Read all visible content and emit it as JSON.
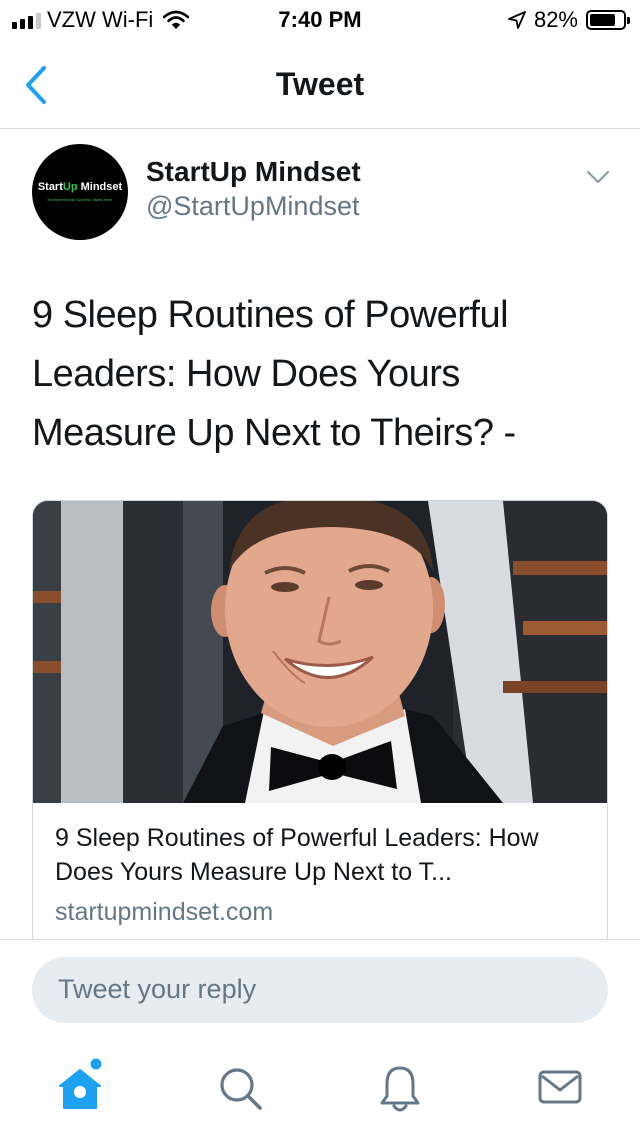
{
  "status_bar": {
    "carrier": "VZW Wi-Fi",
    "time": "7:40 PM",
    "battery_percent": "82%",
    "battery_level": 0.82,
    "signal_bars_active": 3,
    "icons": [
      "signal-icon",
      "wifi-icon",
      "location-arrow-icon",
      "battery-icon"
    ]
  },
  "nav": {
    "title": "Tweet",
    "back_icon": "chevron-left-icon"
  },
  "author": {
    "name": "StartUp Mindset",
    "handle": "@StartUpMindset",
    "avatar": {
      "text_start": "Start",
      "text_up": "Up",
      "text_end": " Mindset",
      "tagline": "Entrepreneurial Success Starts Here"
    },
    "menu_icon": "chevron-down-icon"
  },
  "tweet": {
    "text": "9 Sleep Routines of Powerful Leaders: How Does Yours Measure Up Next to Theirs? -"
  },
  "link_card": {
    "title": "9 Sleep Routines of Powerful Leaders: How Does Yours Measure Up Next to T...",
    "domain": "startupmindset.com"
  },
  "reply": {
    "placeholder": "Tweet your reply"
  },
  "tabs": [
    {
      "icon": "home-icon",
      "active": true,
      "has_notification_dot": true
    },
    {
      "icon": "search-icon",
      "active": false
    },
    {
      "icon": "bell-icon",
      "active": false
    },
    {
      "icon": "mail-icon",
      "active": false
    }
  ],
  "colors": {
    "accent": "#1da1f2",
    "text": "#14171a",
    "secondary_text": "#657786",
    "reply_bg": "#e6ecf0",
    "avatar_up": "#3cc04a"
  }
}
